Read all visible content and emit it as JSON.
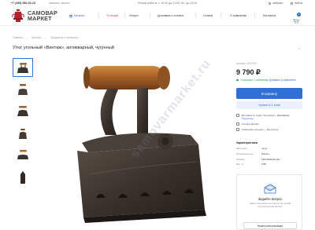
{
  "topbar": {
    "phone": "+7 (495) 580-30-15",
    "callback": "заказать звонок",
    "hours": "Режим работы: с 10:00 до 21:00, Вс. до 19:00",
    "account": "кабинет",
    "login": "войти"
  },
  "logo": {
    "line1": "САМОВАР",
    "line2": "МАРКЕТ"
  },
  "nav": {
    "catalog": "Каталог",
    "sale": "% Акции",
    "services": "Услуги",
    "delivery": "Доставка и оплата",
    "articles": "Статьи",
    "about": "О компании",
    "contacts": "Контакты",
    "cart_count": "0"
  },
  "breadcrumbs": [
    "Главная",
    "Каталог",
    "Предметы и интерьер..."
  ],
  "product": {
    "title": "Утюг угольный «Винтаж», антикварный, чугунный",
    "sku": "Артикул: КЗЛ-057",
    "price": "9 790 ₽",
    "stock": "В наличии: 1 экземпляр",
    "compare": "Добавить к сравнению",
    "add_to_cart": "В корзину",
    "one_click": "Купить в 1 клик",
    "delivery_line1": "Доставим по Санкт-Петербургу:",
    "delivery_bold": "бесплатно",
    "delivery_link": "Подробнее",
    "guarantee": "Отзыв в Москве",
    "pickup": "Самовывоз сегодня — Бесплатно"
  },
  "specs": {
    "title": "Характеристики",
    "rows": [
      {
        "k": "Материал",
        "v": "чугун"
      },
      {
        "k": "Производитель",
        "v": "Россия"
      },
      {
        "k": "Размер",
        "v": "125х190х140 мм"
      },
      {
        "k": "Вес, кг",
        "v": "3,55"
      }
    ]
  },
  "question": {
    "title": "Задайте вопрос",
    "desc": "Наши специалисты ответят на любой интересующий вопрос",
    "button": "Нужна консультация"
  },
  "watermark": "samovarmarket.ru",
  "colors": {
    "accent": "#2f6fd6",
    "sale": "#d83a3a",
    "stock": "#2aa34a"
  }
}
